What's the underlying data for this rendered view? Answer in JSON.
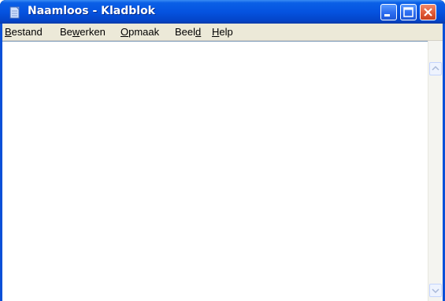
{
  "window": {
    "title": "Naamloos - Kladblok",
    "app_icon": "notepad-icon",
    "controls": {
      "minimize_icon": "minimize-icon",
      "maximize_icon": "maximize-icon",
      "close_icon": "close-icon"
    }
  },
  "menubar": {
    "items": [
      {
        "pre": "",
        "key": "B",
        "post": "estand"
      },
      {
        "pre": "Be",
        "key": "w",
        "post": "erken"
      },
      {
        "pre": "",
        "key": "O",
        "post": "pmaak"
      },
      {
        "pre": "Beel",
        "key": "d",
        "post": ""
      },
      {
        "pre": "",
        "key": "H",
        "post": "elp"
      }
    ]
  },
  "editor": {
    "content": ""
  },
  "colors": {
    "titlebar": "#0553e0",
    "close_button": "#e25a36",
    "menubar": "#ece9d8"
  }
}
